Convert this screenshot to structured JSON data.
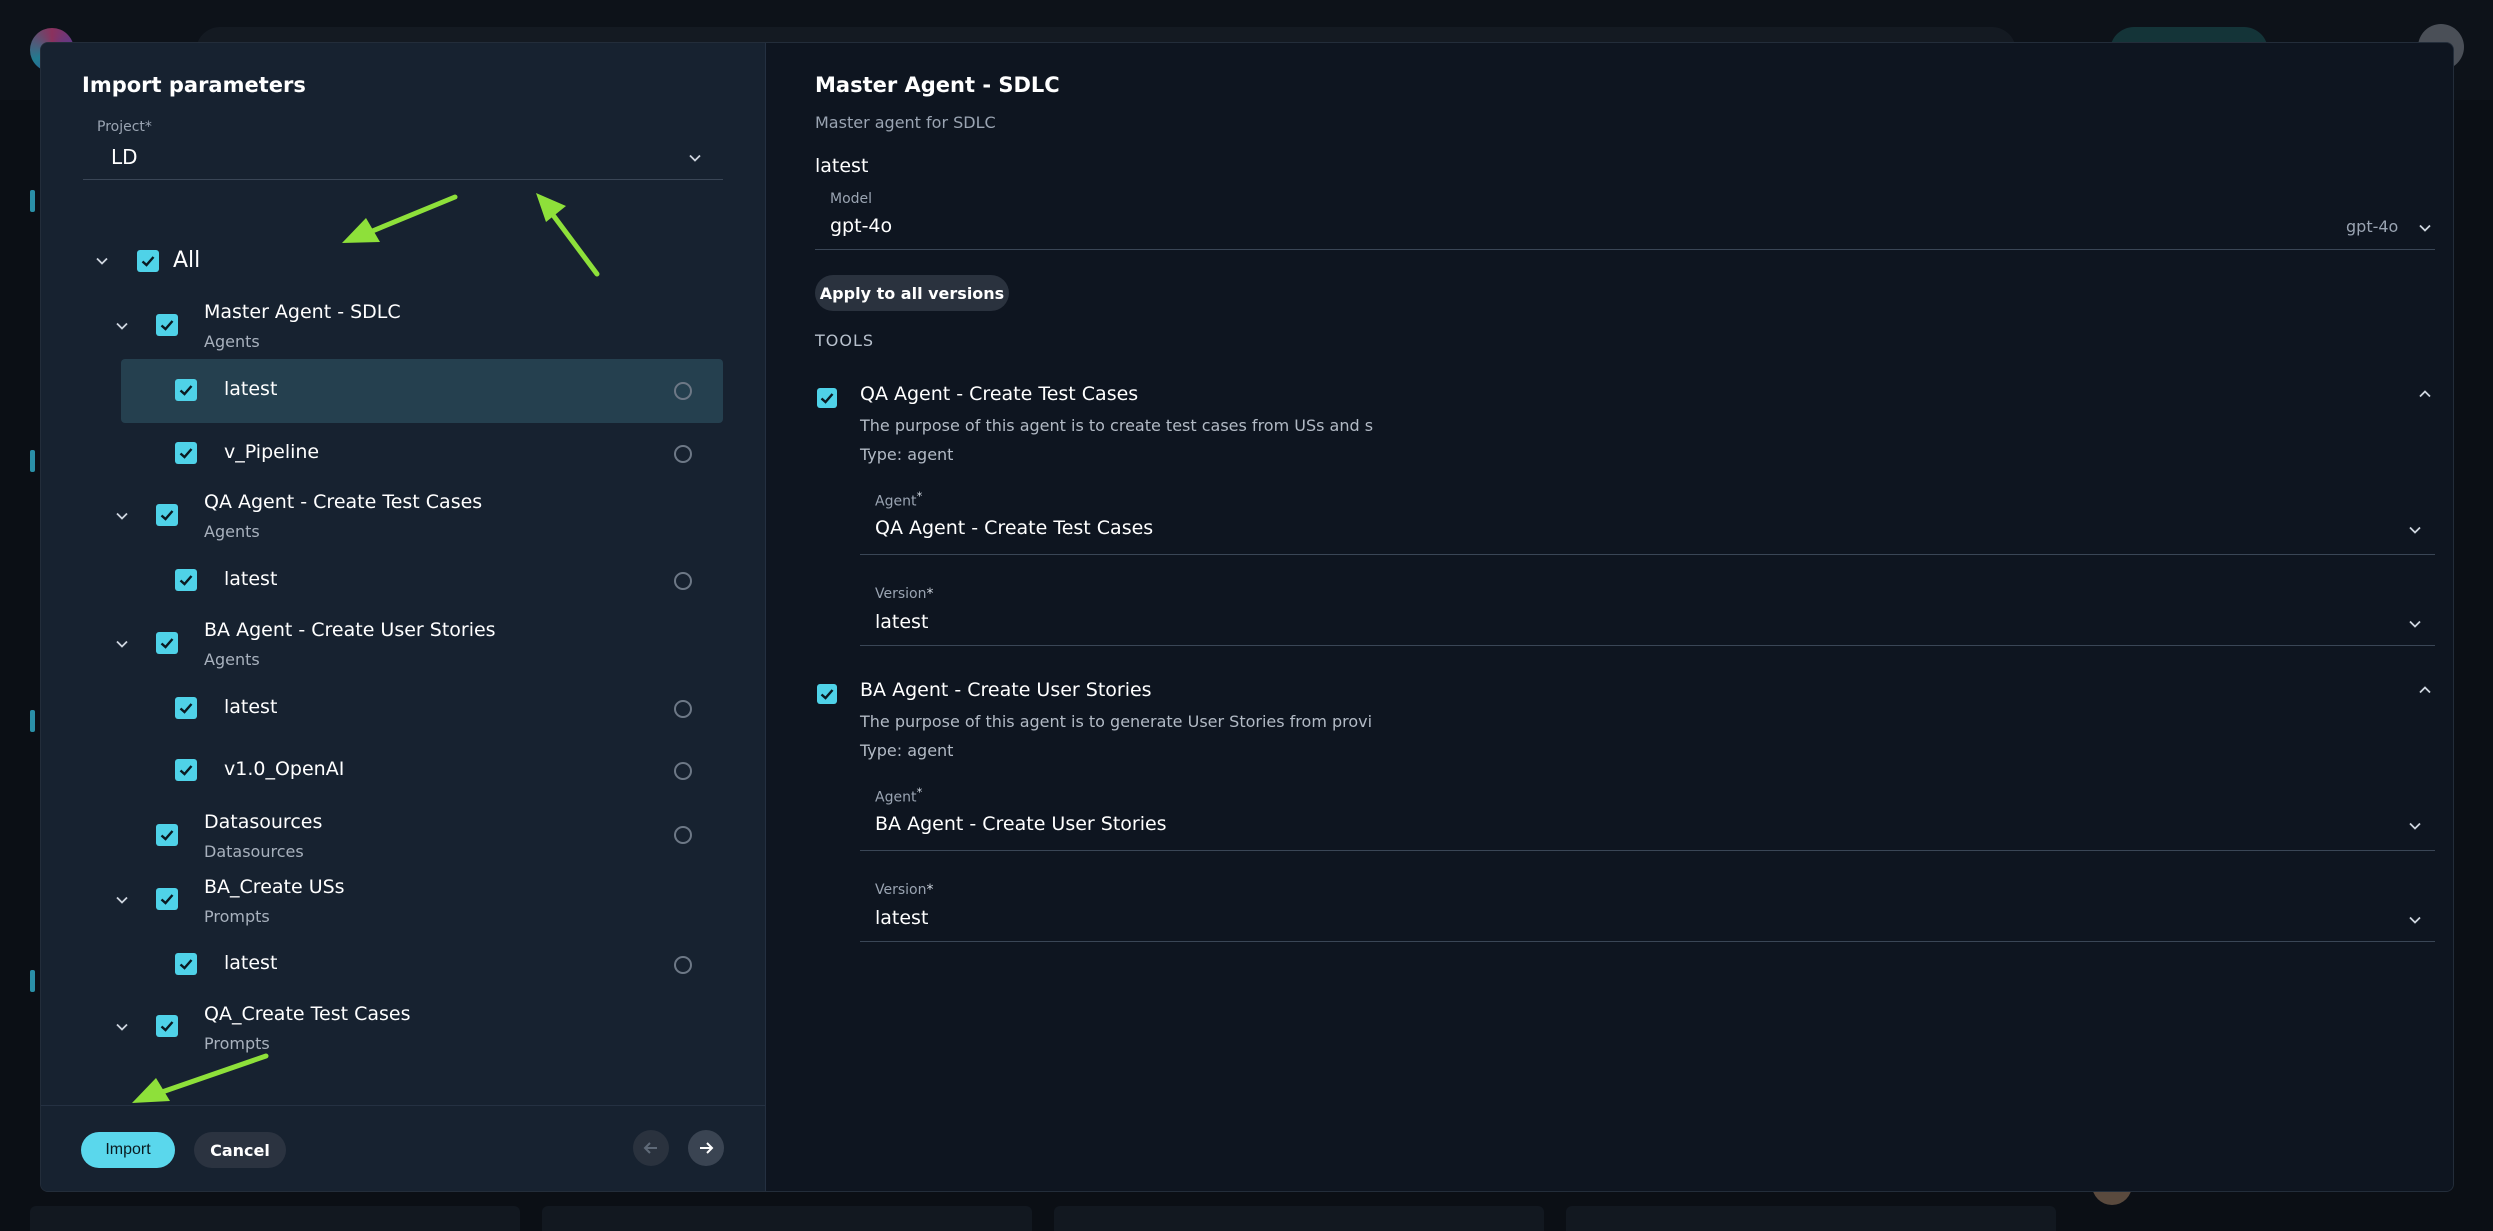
{
  "colors": {
    "accent": "#4fd2e8",
    "import_button": "#5ad7ec",
    "panel_left": "#172230",
    "panel_right": "#0e1520",
    "highlight_row": "#25404f",
    "annotation_arrow": "#8ee03a"
  },
  "left_panel": {
    "title": "Import parameters",
    "project": {
      "label": "Project*",
      "value": "LD",
      "icon": "chevron-down-icon"
    },
    "tree": {
      "all_label": "All",
      "groups": [
        {
          "name": "Master Agent - SDLC",
          "type": "Agents",
          "versions": [
            "latest",
            "v_Pipeline"
          ]
        },
        {
          "name": "QA Agent - Create Test Cases",
          "type": "Agents",
          "versions": [
            "latest"
          ]
        },
        {
          "name": "BA Agent - Create User Stories",
          "type": "Agents",
          "versions": [
            "latest",
            "v1.0_OpenAI"
          ]
        },
        {
          "name": "Datasources",
          "type": "Datasources",
          "versions": []
        },
        {
          "name": "BA_Create USs",
          "type": "Prompts",
          "versions": [
            "latest"
          ]
        },
        {
          "name": "QA_Create Test Cases",
          "type": "Prompts",
          "versions": []
        }
      ]
    },
    "footer": {
      "import_label": "Import",
      "cancel_label": "Cancel",
      "prev_icon": "arrow-left-icon",
      "next_icon": "arrow-right-icon"
    }
  },
  "right_panel": {
    "title": "Master Agent - SDLC",
    "description": "Master agent for SDLC",
    "version_name": "latest",
    "model": {
      "label": "Model",
      "value": "gpt-4o",
      "hint": "gpt-4o"
    },
    "apply_label": "Apply to all versions",
    "tools_header": "TOOLS",
    "tools": [
      {
        "name": "QA Agent - Create Test Cases",
        "description": "The purpose of this agent is to create test cases from USs and s",
        "type": "Type: agent",
        "agent_label": "Agent",
        "agent_value": "QA Agent - Create Test Cases",
        "version_label": "Version",
        "version_value": "latest"
      },
      {
        "name": "BA Agent - Create User Stories",
        "description": "The purpose of this agent is to generate User Stories from provi",
        "type": "Type: agent",
        "agent_label": "Agent",
        "agent_value": "BA Agent - Create User Stories",
        "version_label": "Version",
        "version_value": "latest"
      }
    ],
    "required_mark": "*"
  }
}
